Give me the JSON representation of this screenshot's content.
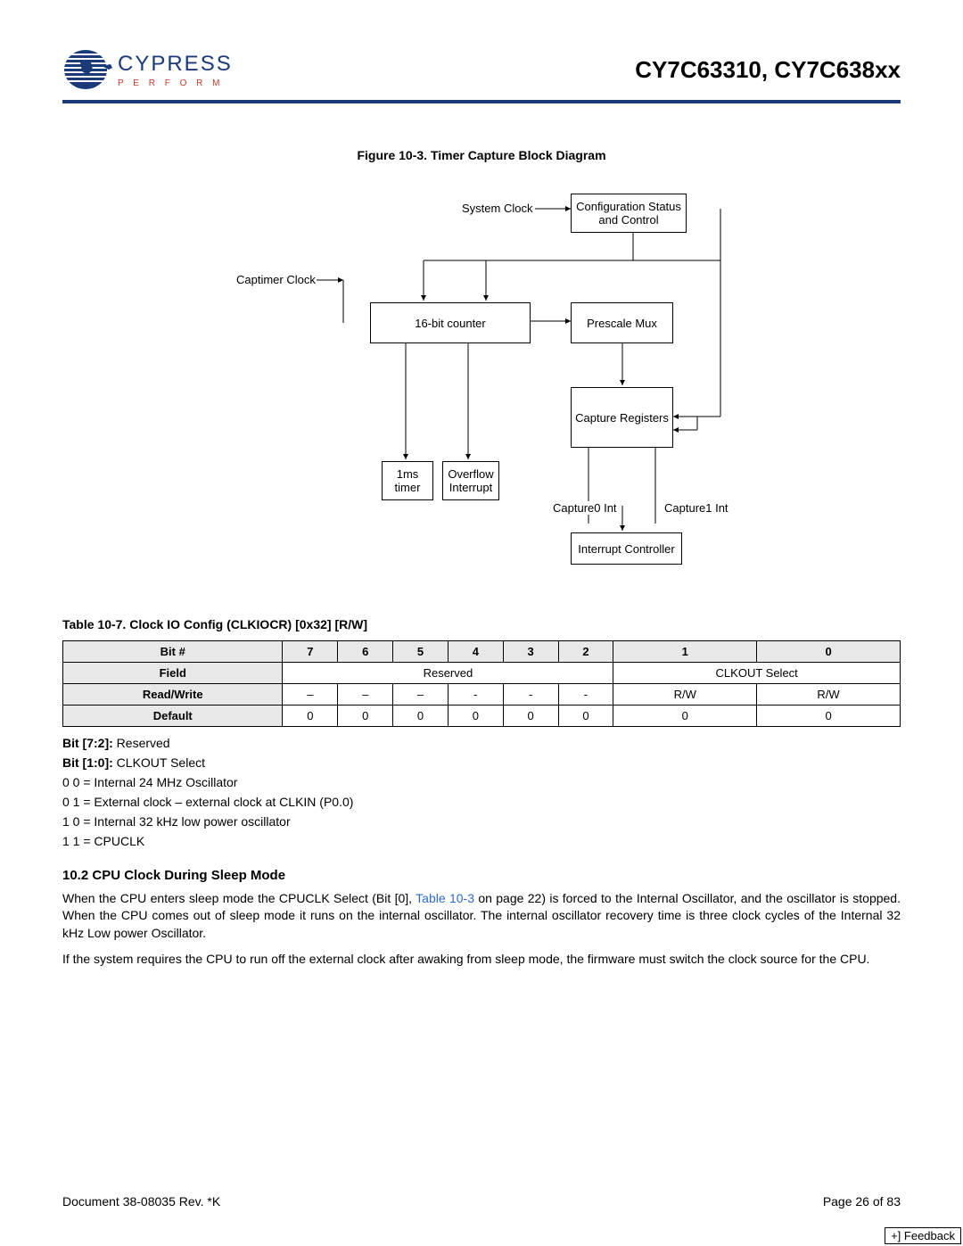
{
  "header": {
    "logo_text": "CYPRESS",
    "logo_tagline": "P E R F O R M",
    "doc_title": "CY7C63310, CY7C638xx"
  },
  "figure": {
    "title": "Figure 10-3.  Timer Capture Block Diagram",
    "labels": {
      "system_clock": "System Clock",
      "config_status": "Configuration Status and Control",
      "captimer_clock": "Captimer Clock",
      "counter": "16-bit counter",
      "prescale_mux": "Prescale Mux",
      "capture_registers": "Capture Registers",
      "timer_1ms": "1ms timer",
      "overflow_interrupt": "Overflow Interrupt",
      "capture0_int": "Capture0 Int",
      "capture1_int": "Capture1 Int",
      "interrupt_controller": "Interrupt Controller"
    }
  },
  "table": {
    "title": "Table 10-7.  Clock IO Config (CLKIOCR) [0x32] [R/W]",
    "headers": [
      "Bit #",
      "7",
      "6",
      "5",
      "4",
      "3",
      "2",
      "1",
      "0"
    ],
    "rows": [
      {
        "label": "Field",
        "cells_merged": {
          "reserved_span": 6,
          "reserved_text": "Reserved",
          "select_span": 2,
          "select_text": "CLKOUT Select"
        }
      },
      {
        "label": "Read/Write",
        "cells": [
          "–",
          "–",
          "–",
          "-",
          "-",
          "-",
          "R/W",
          "R/W"
        ]
      },
      {
        "label": "Default",
        "cells": [
          "0",
          "0",
          "0",
          "0",
          "0",
          "0",
          "0",
          "0"
        ]
      }
    ]
  },
  "notes": {
    "bit72_label": "Bit [7:2]:",
    "bit72_text": " Reserved",
    "bit10_label": "Bit [1:0]:",
    "bit10_text": " CLKOUT Select",
    "l1": "0 0 = Internal 24 MHz Oscillator",
    "l2": "0 1 = External clock – external clock at CLKIN (P0.0)",
    "l3": "1 0 = Internal 32 kHz low power oscillator",
    "l4": "1 1 = CPUCLK"
  },
  "section": {
    "title": "10.2  CPU Clock During Sleep Mode",
    "p1a": "When the CPU enters sleep mode the CPUCLK Select (Bit [0], ",
    "p1_link": "Table 10-3",
    "p1b": " on page 22) is forced to the Internal Oscillator, and the oscillator is stopped. When the CPU comes out of sleep mode it runs on the internal oscillator. The internal oscillator recovery time is three clock cycles of the Internal 32 kHz Low power Oscillator.",
    "p2": "If the system requires the CPU to run off the external clock after awaking from sleep mode, the firmware must switch the clock source for the CPU."
  },
  "footer": {
    "left": "Document 38-08035 Rev. *K",
    "right": "Page 26 of 83",
    "feedback": "+] Feedback"
  }
}
